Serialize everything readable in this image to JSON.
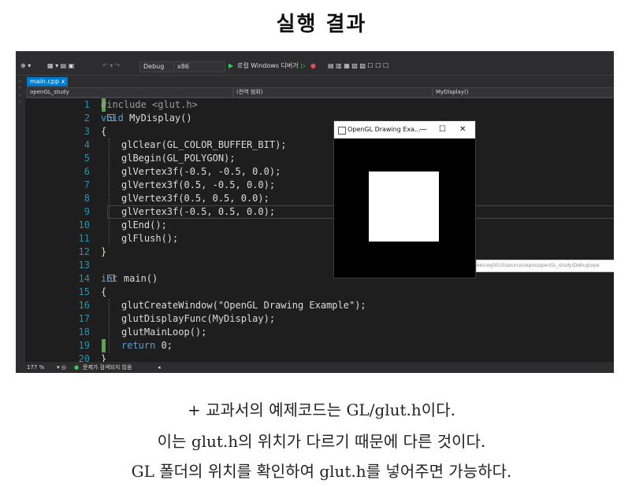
{
  "page": {
    "title": "실행 결과"
  },
  "screenshot": {
    "toolbar": {
      "config": "Debug",
      "platform": "x86",
      "run_label": "로컬 Windows 디버거"
    },
    "tab": {
      "label": "main.cpp"
    },
    "navbar": {
      "project": "openGL_study",
      "scope": "(전역 범위)",
      "function": "MyDisplay()"
    },
    "code_lines": [
      {
        "n": "1",
        "text": "#include <glut.h>"
      },
      {
        "n": "2",
        "text": "void MyDisplay()"
      },
      {
        "n": "3",
        "text": "{"
      },
      {
        "n": "4",
        "text": "glClear(GL_COLOR_BUFFER_BIT);"
      },
      {
        "n": "5",
        "text": "glBegin(GL_POLYGON);"
      },
      {
        "n": "6",
        "text": "glVertex3f(-0.5, -0.5, 0.0);"
      },
      {
        "n": "7",
        "text": "glVertex3f(0.5, -0.5, 0.0);"
      },
      {
        "n": "8",
        "text": "glVertex3f(0.5, 0.5, 0.0);"
      },
      {
        "n": "9",
        "text": "glVertex3f(-0.5, 0.5, 0.0);"
      },
      {
        "n": "10",
        "text": "glEnd();"
      },
      {
        "n": "11",
        "text": "glFlush();"
      },
      {
        "n": "12",
        "text": "}"
      },
      {
        "n": "13",
        "text": ""
      },
      {
        "n": "14",
        "text": "int main()"
      },
      {
        "n": "15",
        "text": "{"
      },
      {
        "n": "16",
        "text": "glutCreateWindow(\"OpenGL Drawing Example\");"
      },
      {
        "n": "17",
        "text": "glutDisplayFunc(MyDisplay);"
      },
      {
        "n": "18",
        "text": "glutMainLoop();"
      },
      {
        "n": "19",
        "text": "return 0;"
      },
      {
        "n": "20",
        "text": "}"
      }
    ],
    "gl_window": {
      "title": "OpenGL Drawing Exa..."
    },
    "path_text": "ee\\ceg5010\\source\\repos\\openGL_study\\Debug\\ope",
    "status": {
      "zoom": "177 %",
      "message": "문제가 검색되지 않음"
    },
    "colors": {
      "accent": "#007acc",
      "editor_bg": "#1e1e1e",
      "line_number": "#2b91af",
      "keyword": "#569cd6"
    }
  },
  "notes": [
    "+ 교과서의 예제코드는 GL/glut.h이다.",
    "이는 glut.h의 위치가 다르기 때문에 다른 것이다.",
    "GL 폴더의 위치를 확인하여 glut.h를 넣어주면 가능하다."
  ]
}
